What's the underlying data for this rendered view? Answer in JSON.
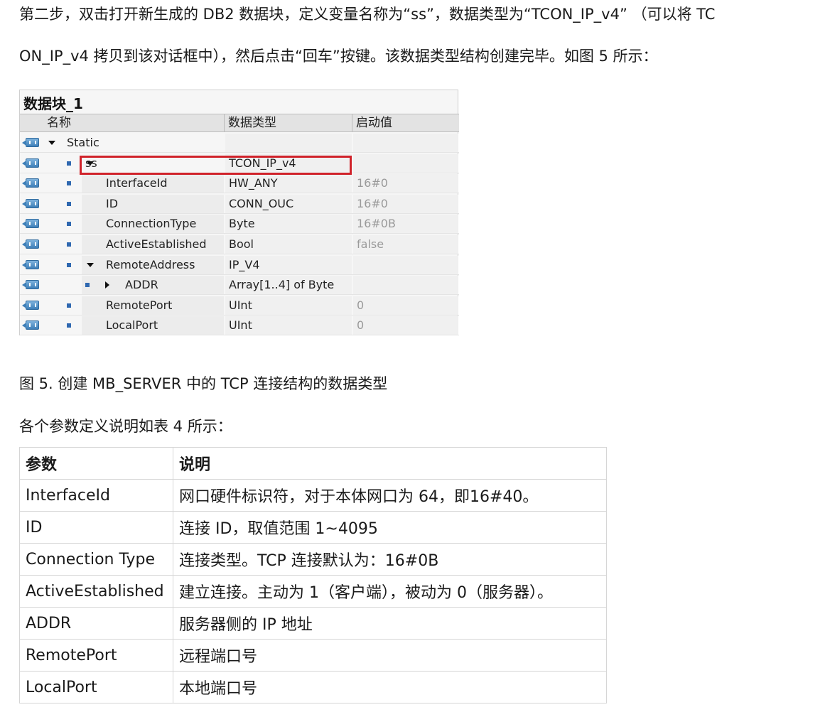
{
  "paragraphs": {
    "line1": "第二步，双击打开新生成的 DB2 数据块，定义变量名称为“ss”，数据类型为“TCON_IP_v4” （可以将 TC",
    "line2": "ON_IP_v4 拷贝到该对话框中），然后点击“回车”按键。该数据类型结构创建完毕。如图 5 所示："
  },
  "figure": {
    "title": "数据块_1",
    "columns": [
      "名称",
      "数据类型",
      "启动值"
    ],
    "rows": [
      {
        "name": "Static",
        "type": "",
        "value": "",
        "level": 0,
        "expand": "down",
        "bullet": false
      },
      {
        "name": "ss",
        "type": "TCON_IP_v4",
        "value": "",
        "level": 1,
        "expand": "down",
        "bullet": true
      },
      {
        "name": "InterfaceId",
        "type": "HW_ANY",
        "value": "16#0",
        "level": 2,
        "expand": "",
        "bullet": true
      },
      {
        "name": "ID",
        "type": "CONN_OUC",
        "value": "16#0",
        "level": 2,
        "expand": "",
        "bullet": true
      },
      {
        "name": "ConnectionType",
        "type": "Byte",
        "value": "16#0B",
        "level": 2,
        "expand": "",
        "bullet": true
      },
      {
        "name": "ActiveEstablished",
        "type": "Bool",
        "value": "false",
        "level": 2,
        "expand": "",
        "bullet": true
      },
      {
        "name": "RemoteAddress",
        "type": "IP_V4",
        "value": "",
        "level": 2,
        "expand": "down",
        "bullet": true
      },
      {
        "name": "ADDR",
        "type": "Array[1..4] of Byte",
        "value": "",
        "level": 3,
        "expand": "right",
        "bullet": true
      },
      {
        "name": "RemotePort",
        "type": "UInt",
        "value": "0",
        "level": 2,
        "expand": "",
        "bullet": true
      },
      {
        "name": "LocalPort",
        "type": "UInt",
        "value": "0",
        "level": 2,
        "expand": "",
        "bullet": true
      }
    ],
    "icon": "db-interface-icon",
    "highlight_color": "#d0222a"
  },
  "caption": "图 5. 创建 MB_SERVER 中的 TCP 连接结构的数据类型",
  "table_intro": "各个参数定义说明如表 4 所示：",
  "param_table": {
    "headers": [
      "参数",
      "说明"
    ],
    "rows": [
      [
        "InterfaceId",
        "网口硬件标识符，对于本体网口为 64，即16#40。"
      ],
      [
        "ID",
        "连接 ID，取值范围 1~4095"
      ],
      [
        "Connection Type",
        "连接类型。TCP 连接默认为：16#0B"
      ],
      [
        "ActiveEstablished",
        "建立连接。主动为 1（客户端），被动为 0（服务器）。"
      ],
      [
        "ADDR",
        "服务器侧的 IP 地址"
      ],
      [
        "RemotePort",
        "远程端口号"
      ],
      [
        "LocalPort",
        "本地端口号"
      ]
    ]
  }
}
